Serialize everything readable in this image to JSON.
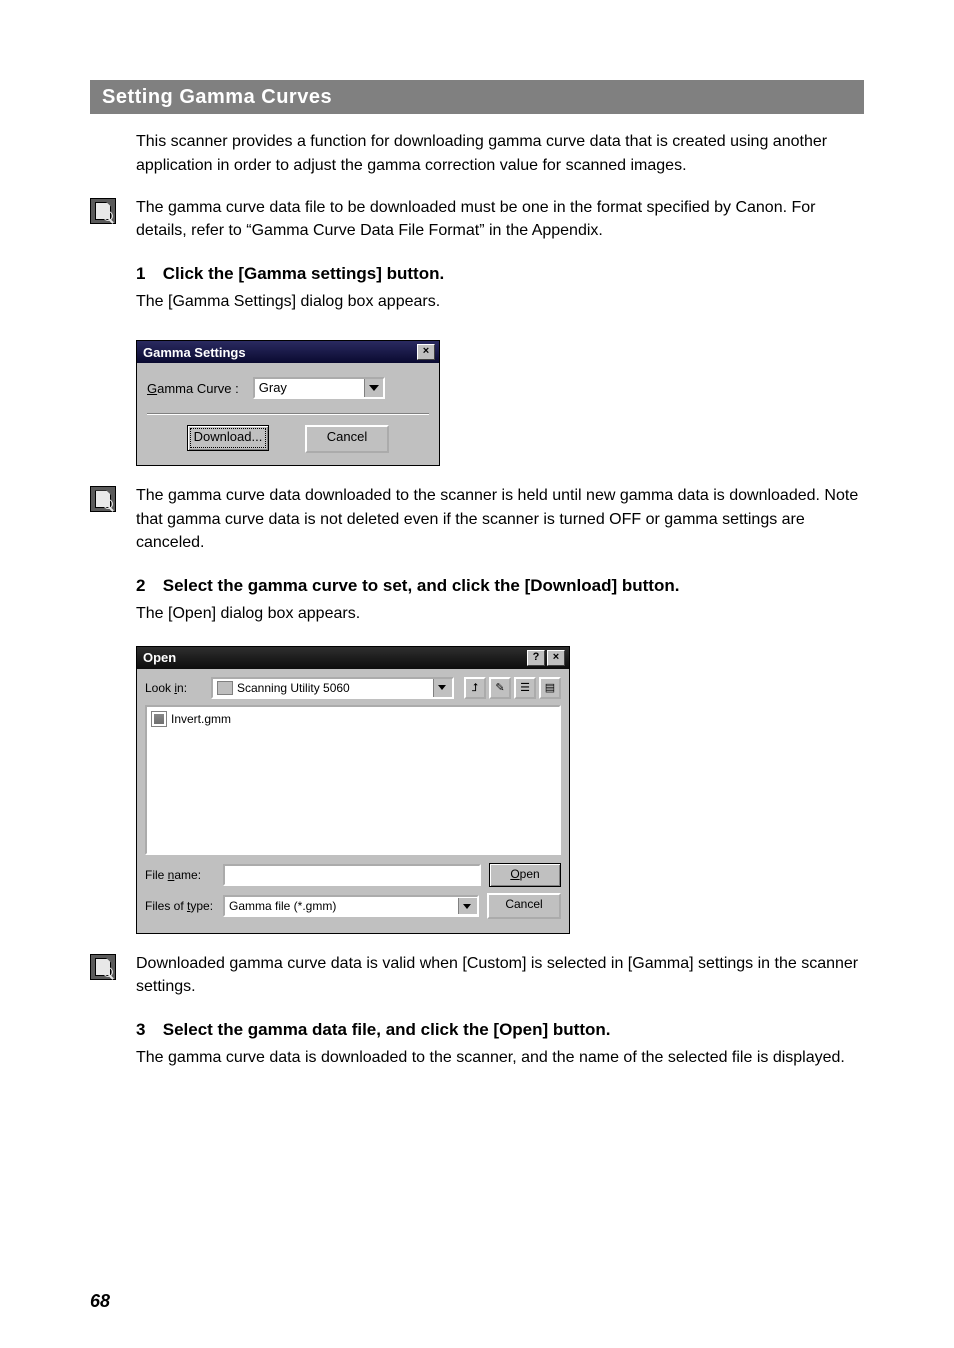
{
  "section": {
    "title": "Setting Gamma Curves"
  },
  "intro": "This scanner provides a function for downloading gamma curve data that is created using another application in order to adjust the gamma correction value for scanned images.",
  "notes": [
    "The gamma curve data file to be downloaded must be one in the format specified by Canon. For details, refer to “Gamma Curve Data File Format” in the Appendix.",
    "The gamma curve data downloaded to the scanner is held until new gamma data is downloaded. Note that gamma curve data is not deleted even if the scanner is turned OFF or gamma settings are canceled.",
    "Downloaded gamma curve data is valid when [Custom] is selected in [Gamma] settings in the scanner settings."
  ],
  "steps": [
    {
      "num": "1",
      "head": "Click the [Gamma settings] button.",
      "desc": "The [Gamma Settings] dialog box appears."
    },
    {
      "num": "2",
      "head": "Select the gamma curve to set, and click the [Download] button.",
      "desc": "The [Open] dialog box appears."
    },
    {
      "num": "3",
      "head": "Select the gamma data file, and click the [Open] button.",
      "desc": "The gamma curve data is downloaded to the scanner, and the name of the selected file is displayed."
    }
  ],
  "gamma_dialog": {
    "title": "Gamma Settings",
    "close": "×",
    "label_prefix": "G",
    "label_rest": "amma Curve :",
    "combo_value": "Gray",
    "download_btn": "Download...",
    "cancel_btn": "Cancel"
  },
  "open_dialog": {
    "title": "Open",
    "help": "?",
    "close": "×",
    "lookin_prefix": "Look ",
    "lookin_ul": "i",
    "lookin_rest": "n:",
    "lookin_value": "Scanning Utility 5060",
    "tool_up": "⮥",
    "tool_new": "✎",
    "tool_list": "☰",
    "tool_details": "▤",
    "file_item": "Invert.gmm",
    "filename_label_pre": "File ",
    "filename_ul": "n",
    "filename_label_post": "ame:",
    "filename_value": "",
    "filetype_label_pre": "Files of ",
    "filetype_ul": "t",
    "filetype_label_post": "ype:",
    "filetype_value": "Gamma file (*.gmm)",
    "open_ul": "O",
    "open_rest": "pen",
    "cancel": "Cancel"
  },
  "page_number": "68"
}
